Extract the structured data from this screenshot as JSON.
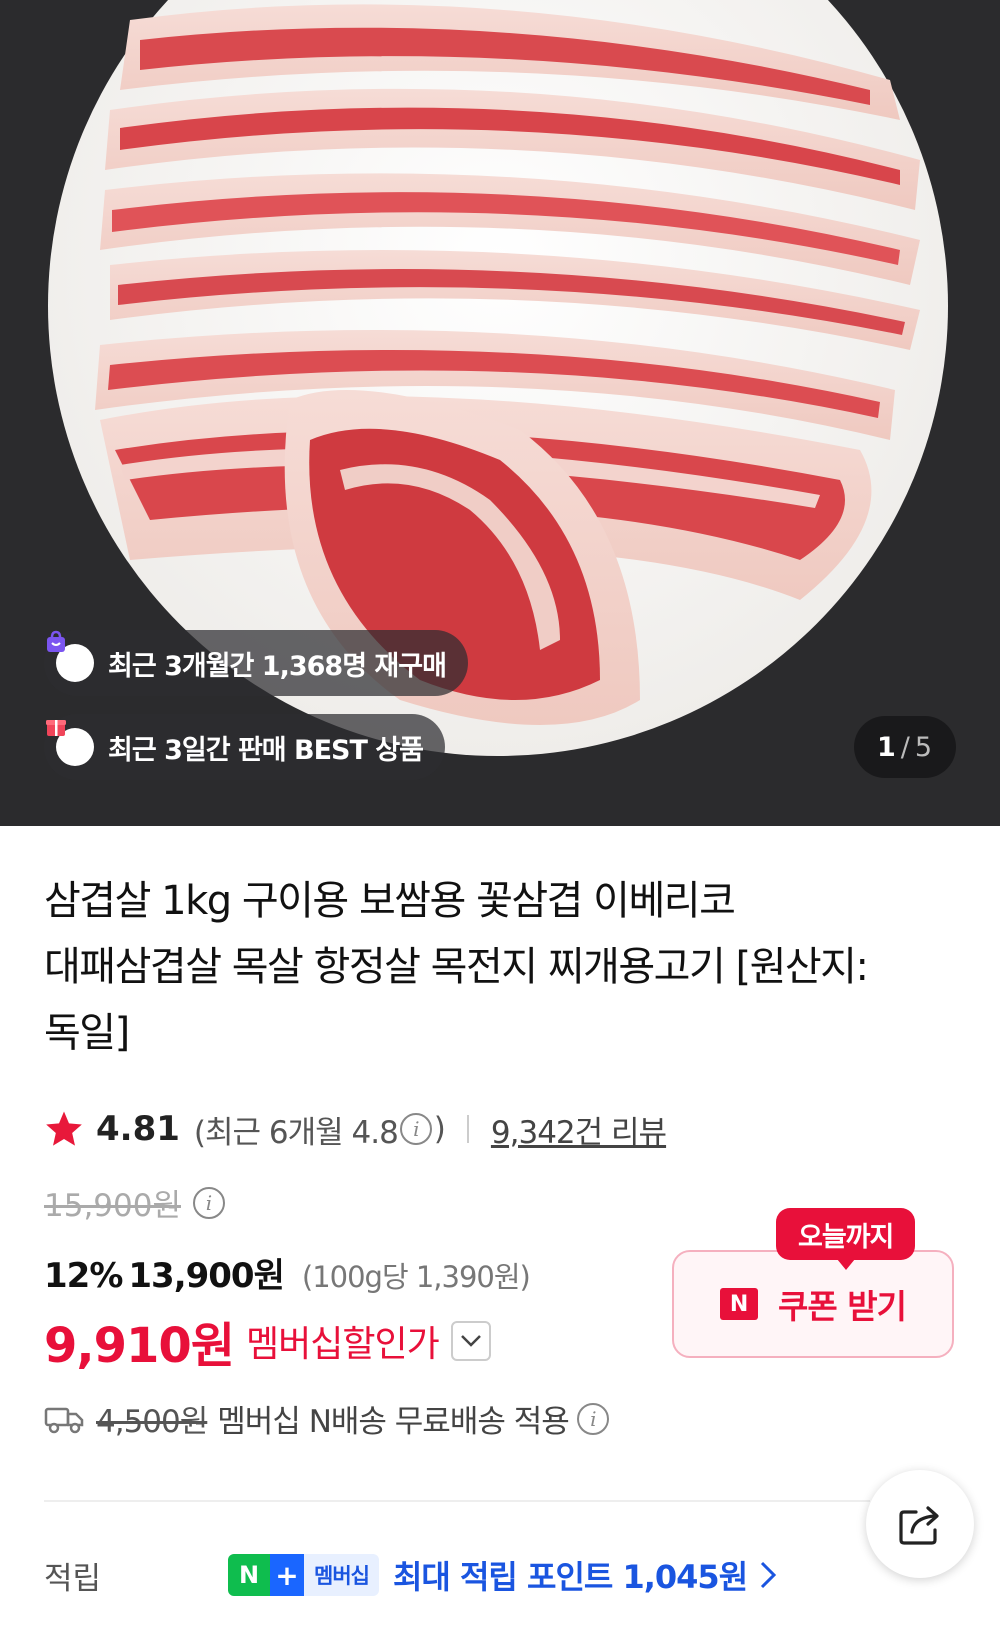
{
  "hero": {
    "badge_repurchase": "최근 3개월간 1,368명 재구매",
    "badge_best": "최근 3일간 판매 BEST 상품",
    "image_index": "1",
    "image_total": "5",
    "image_sep": "/"
  },
  "product": {
    "title_line1": "삼겹살 1kg 구이용 보쌈용 꽃삼겹 이베리코",
    "title_line2": "대패삼겹살 목살 항정살 목전지 찌개용고기 [원산지:",
    "title_line3": "독일]"
  },
  "rating": {
    "score": "4.81",
    "recent_prefix": "(최근 6개월 4.8",
    "recent_suffix": ")",
    "reviews": "9,342건 리뷰"
  },
  "price": {
    "original": "15,900원",
    "discount_pct": "12%",
    "sale": "13,900원",
    "unit_price": "(100g당 1,390원)",
    "member_price": "9,910원",
    "member_label": "멤버십할인가"
  },
  "coupon": {
    "tag": "오늘까지",
    "logo": "N",
    "label": "쿠폰 받기"
  },
  "shipping": {
    "original_fee": "4,500원",
    "text": "멤버십 N배송 무료배송 적용"
  },
  "points": {
    "label": "적립",
    "badge_n": "N",
    "badge_plus": "+",
    "badge_text": "멤버십",
    "text": "최대 적립 포인트 1,045원"
  },
  "colors": {
    "accent_red": "#e8103a",
    "accent_blue": "#1a55e0",
    "naver_green": "#0fbd4e"
  },
  "icons": [
    "star-icon",
    "info-icon",
    "chevron-down-icon",
    "truck-icon",
    "share-icon",
    "chevron-right-icon",
    "bag-icon",
    "gift-icon"
  ]
}
